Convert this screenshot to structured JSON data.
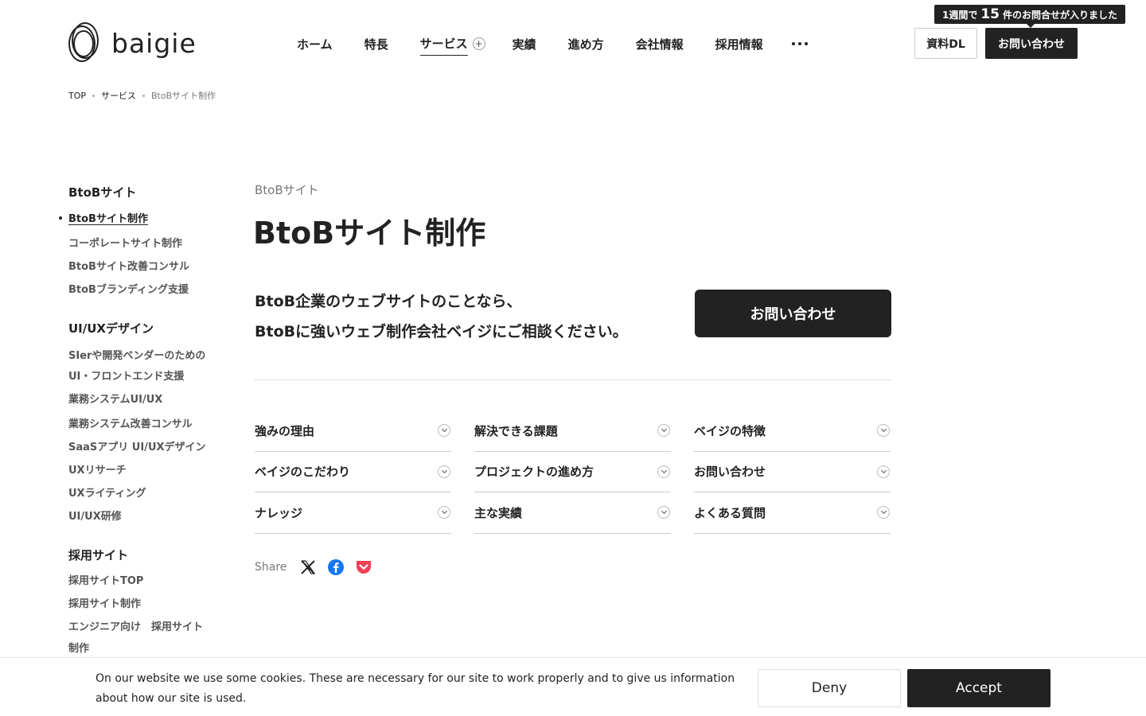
{
  "header": {
    "logo_text": "baigie",
    "nav": [
      {
        "label": "ホーム"
      },
      {
        "label": "特長"
      },
      {
        "label": "サービス"
      },
      {
        "label": "実績"
      },
      {
        "label": "進め方"
      },
      {
        "label": "会社情報"
      },
      {
        "label": "採用情報"
      }
    ],
    "tooltip": {
      "prefix": "1週間で",
      "count": "15",
      "suffix": "件のお問合せが入りました"
    },
    "download_label": "資料DL",
    "contact_label": "お問い合わせ"
  },
  "breadcrumb": [
    "TOP",
    "サービス",
    "BtoBサイト制作"
  ],
  "sidebar": {
    "groups": [
      {
        "heading": "BtoBサイト",
        "items": [
          "BtoBサイト制作",
          "コーポレートサイト制作",
          "BtoBサイト改善コンサル",
          "BtoBブランディング支援"
        ]
      },
      {
        "heading": "UI/UXデザイン",
        "items": [
          "SIerや開発ベンダーのための",
          "UI・フロントエンド支援",
          "業務システムUI/UX",
          "業務システム改善コンサル",
          "SaaSアプリ UI/UXデザイン",
          "UXリサーチ",
          "UXライティング",
          "UI/UX研修"
        ]
      },
      {
        "heading": "採用サイト",
        "items": [
          "採用サイトTOP",
          "採用サイト制作",
          "エンジニア向け　採用サイト",
          "制作"
        ]
      }
    ]
  },
  "main": {
    "eyebrow": "BtoBサイト",
    "title": "BtoBサイト制作",
    "lead_line1": "BtoB企業のウェブサイトのことなら、",
    "lead_line2": "BtoBに強いウェブ制作会社ベイジにご相談ください。",
    "contact_button": "お問い合わせ",
    "anchors": [
      "強みの理由",
      "解決できる課題",
      "ベイジの特徴",
      "ベイジのこだわり",
      "プロジェクトの進め方",
      "お問い合わせ",
      "ナレッジ",
      "主な実績",
      "よくある質問"
    ],
    "share_label": "Share"
  },
  "cookie": {
    "text": "On our website we use some cookies. These are necessary for our site to work properly and to give us information about how our site is used.",
    "deny": "Deny",
    "accept": "Accept"
  }
}
